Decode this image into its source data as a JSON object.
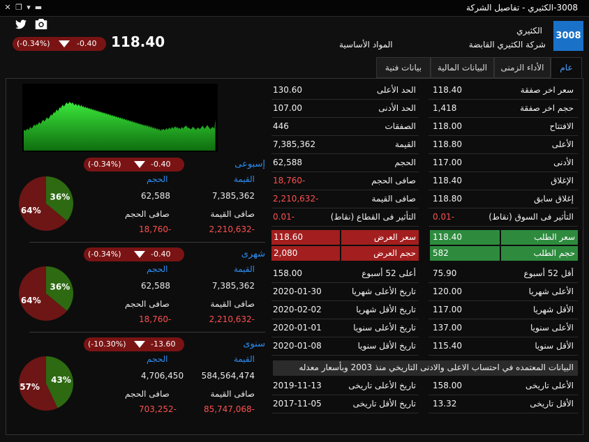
{
  "window": {
    "title": "3008-الكثيري - تفاصيل الشركة"
  },
  "header": {
    "symbol": "3008",
    "name_short": "الكثيري",
    "name_full": "شركة الكثيري القابضة",
    "sector": "المواد الأساسية",
    "price": "118.40",
    "change": "-0.40",
    "change_pct": "(-0.34%)",
    "icons": [
      "twitter-icon",
      "camera-icon"
    ]
  },
  "tabs": [
    {
      "label": "عام",
      "active": true
    },
    {
      "label": "الأداء الزمنى",
      "active": false
    },
    {
      "label": "البيانات المالية",
      "active": false
    },
    {
      "label": "بيانات فنية",
      "active": false
    }
  ],
  "right_col": [
    {
      "label": "سعر اخر صفقة",
      "value": "118.40"
    },
    {
      "label": "حجم اخر صفقة",
      "value": "1,418"
    },
    {
      "label": "الافتتاح",
      "value": "118.00"
    },
    {
      "label": "الأعلى",
      "value": "118.80"
    },
    {
      "label": "الأدنى",
      "value": "117.00"
    },
    {
      "label": "الإغلاق",
      "value": "118.40"
    },
    {
      "label": "إغلاق سابق",
      "value": "118.80"
    },
    {
      "label": "التأثير فى السوق (نقاط)",
      "value": "0.01-",
      "color": "neg"
    }
  ],
  "mid_col": [
    {
      "label": "الحد الأعلى",
      "value": "130.60"
    },
    {
      "label": "الحد الأدنى",
      "value": "107.00"
    },
    {
      "label": "الصفقات",
      "value": "446"
    },
    {
      "label": "القيمة",
      "value": "7,385,362"
    },
    {
      "label": "الحجم",
      "value": "62,588"
    },
    {
      "label": "صافى الحجم",
      "value": "18,760-",
      "color": "neg"
    },
    {
      "label": "صافى القيمة",
      "value": "2,210,632-",
      "color": "neg"
    },
    {
      "label": "التأثير فى القطاع (نقاط)",
      "value": "0.01-",
      "color": "neg"
    }
  ],
  "bid": {
    "price_label": "سعر الطلب",
    "price": "118.40",
    "volume_label": "حجم الطلب",
    "volume": "582",
    "color": "#2e8b3e"
  },
  "ask": {
    "price_label": "سعر العرض",
    "price": "118.60",
    "volume_label": "حجم العرض",
    "volume": "2,080",
    "color": "#a31e1e"
  },
  "range_right": [
    {
      "label": "أقل 52 أسبوع",
      "value": "75.90"
    },
    {
      "label": "الأعلى شهريا",
      "value": "120.00"
    },
    {
      "label": "الأقل شهريا",
      "value": "117.00"
    },
    {
      "label": "الأعلى سنويا",
      "value": "137.00"
    },
    {
      "label": "الأقل سنويا",
      "value": "115.40"
    }
  ],
  "range_mid": [
    {
      "label": "أعلى 52 أسبوع",
      "value": "158.00"
    },
    {
      "label": "تاريخ الأعلى شهريا",
      "value": "2020-01-30"
    },
    {
      "label": "تاريخ الأقل شهريا",
      "value": "2020-02-02"
    },
    {
      "label": "تاريخ الأعلى سنويا",
      "value": "2020-01-01"
    },
    {
      "label": "تاريخ الأقل سنويا",
      "value": "2020-01-08"
    }
  ],
  "note": "البيانات المعتمده في احتساب الاعلى والادنى التاريخي منذ 2003 وبأسعار معدله",
  "hist_right": [
    {
      "label": "الأعلى تاريخى",
      "value": "158.00"
    },
    {
      "label": "الأقل تاريخى",
      "value": "13.32"
    }
  ],
  "hist_mid": [
    {
      "label": "تاريخ الأعلى تاريخى",
      "value": "2019-11-13"
    },
    {
      "label": "تاريخ الأقل تاريخى",
      "value": "2017-11-05"
    }
  ],
  "chart_data": {
    "type": "area",
    "color": "#22c322",
    "values": [
      52,
      53,
      51,
      54,
      55,
      52,
      56,
      58,
      55,
      57,
      60,
      62,
      59,
      63,
      61,
      64,
      66,
      63,
      65,
      68,
      70,
      67,
      69,
      72,
      74,
      71,
      73,
      76,
      79,
      77,
      80,
      83,
      81,
      85,
      87,
      84,
      88,
      91,
      89,
      93,
      95,
      92,
      94,
      97,
      99,
      96,
      98,
      100,
      98,
      97,
      99,
      96,
      94,
      97,
      95,
      93,
      96,
      94,
      92,
      95,
      91,
      93,
      90,
      92,
      89,
      91,
      88,
      90,
      87,
      89,
      86,
      88,
      85,
      87,
      84,
      86,
      83,
      85,
      82,
      84,
      81,
      83,
      80,
      82,
      79,
      81,
      78,
      80,
      77,
      79,
      76,
      78,
      75,
      77,
      74,
      76,
      73,
      75,
      72,
      74,
      71,
      73,
      70,
      72,
      69,
      71,
      68,
      70,
      67,
      69,
      66,
      68,
      65,
      67,
      64,
      66,
      63,
      65,
      62,
      64,
      61,
      63,
      60,
      62,
      59,
      62,
      58,
      61,
      57,
      60,
      56,
      59,
      55,
      58,
      54,
      57,
      53,
      56,
      52,
      55,
      51,
      54,
      53,
      55,
      52,
      54,
      56,
      53,
      55,
      57,
      54,
      56,
      58,
      55,
      57,
      59,
      56,
      58,
      55,
      57,
      54,
      56,
      58,
      55,
      57,
      59,
      60,
      58,
      56,
      57,
      55,
      54,
      56,
      58,
      57,
      55,
      53,
      55,
      57,
      56,
      54,
      56,
      58,
      60,
      57,
      55,
      57,
      59,
      61,
      58,
      56,
      54,
      56,
      58,
      57,
      55,
      70
    ]
  },
  "periods": [
    {
      "label": "إسبوعى",
      "change": "-0.40",
      "change_pct": "(-0.34%)",
      "value_label": "القيمة",
      "value": "7,385,362",
      "volume_label": "الحجم",
      "volume": "62,588",
      "net_value_label": "صافى القيمة",
      "net_value": "2,210,632-",
      "net_volume_label": "صافى الحجم",
      "net_volume": "18,760-",
      "pie": {
        "green": 36,
        "red": 64,
        "green_label": "36%",
        "red_label": "64%"
      }
    },
    {
      "label": "شهرى",
      "change": "-0.40",
      "change_pct": "(-0.34%)",
      "value_label": "القيمة",
      "value": "7,385,362",
      "volume_label": "الحجم",
      "volume": "62,588",
      "net_value_label": "صافى القيمة",
      "net_value": "2,210,632-",
      "net_volume_label": "صافى الحجم",
      "net_volume": "18,760-",
      "pie": {
        "green": 36,
        "red": 64,
        "green_label": "36%",
        "red_label": "64%"
      }
    },
    {
      "label": "سنوى",
      "change": "-13.60",
      "change_pct": "(-10.30%)",
      "value_label": "القيمة",
      "value": "584,564,474",
      "volume_label": "الحجم",
      "volume": "4,706,450",
      "net_value_label": "صافى القيمة",
      "net_value": "85,747,068-",
      "net_volume_label": "صافى الحجم",
      "net_volume": "703,252-",
      "pie": {
        "green": 43,
        "red": 57,
        "green_label": "43%",
        "red_label": "57%"
      }
    }
  ]
}
